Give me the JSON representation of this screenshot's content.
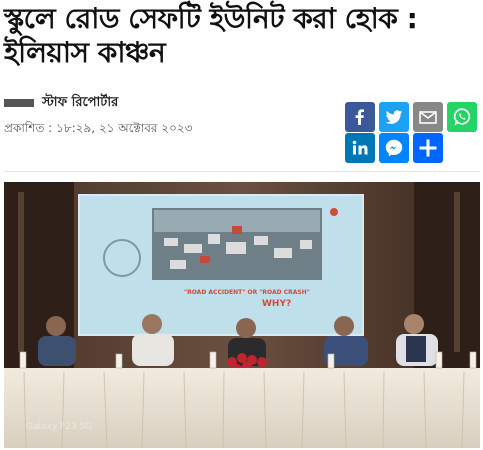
{
  "article": {
    "headline": "স্কুলে রোড সেফটি ইউনিট করা হোক : ইলিয়াস কাঞ্চন",
    "author": "স্টাফ রিপোর্টার",
    "published": "প্রকাশিত : ১৮:২৯, ২১ অক্টোবর ২০২৩"
  },
  "share": {
    "buttons": [
      {
        "name": "facebook-share-button",
        "icon": "facebook-icon",
        "label": "Facebook",
        "color": "#3b5998"
      },
      {
        "name": "twitter-share-button",
        "icon": "twitter-icon",
        "label": "Twitter",
        "color": "#1da1f2"
      },
      {
        "name": "email-share-button",
        "icon": "email-icon",
        "label": "Email",
        "color": "#888888"
      },
      {
        "name": "whatsapp-share-button",
        "icon": "whatsapp-icon",
        "label": "WhatsApp",
        "color": "#25d366"
      },
      {
        "name": "linkedin-share-button",
        "icon": "linkedin-icon",
        "label": "LinkedIn",
        "color": "#0077b5"
      },
      {
        "name": "messenger-share-button",
        "icon": "messenger-icon",
        "label": "Messenger",
        "color": "#0084ff"
      },
      {
        "name": "more-share-button",
        "icon": "plus-icon",
        "label": "Share",
        "color": "#0166ff"
      }
    ]
  },
  "photo": {
    "slide_caption_left": "\"ROAD ACCIDENT\" OR \"ROAD CRASH\"",
    "slide_caption_right": "WHY?",
    "watermark": "Galaxy F23 5G"
  }
}
